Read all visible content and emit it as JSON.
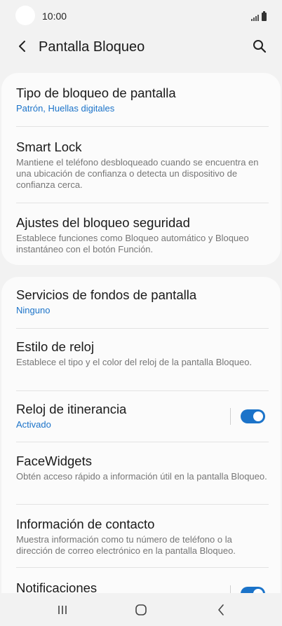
{
  "status_bar": {
    "time": "10:00"
  },
  "app_bar": {
    "title": "Pantalla Bloqueo"
  },
  "colors": {
    "accent": "#1b73c9",
    "background": "#f2f2f2",
    "card": "#fbfbfb"
  },
  "card1": {
    "items": [
      {
        "title": "Tipo de bloqueo de pantalla",
        "subtitle": "Patrón, Huellas digitales"
      },
      {
        "title": "Smart Lock",
        "subtitle": "Mantiene el teléfono desbloqueado cuando se encuentra en una ubicación de confianza o detecta un dispositivo de confianza cerca."
      },
      {
        "title": "Ajustes del bloqueo seguridad",
        "subtitle": "Establece funciones como Bloqueo automático y Bloqueo instantáneo con el botón Función."
      }
    ]
  },
  "card2": {
    "items": [
      {
        "title": "Servicios de fondos de pantalla",
        "subtitle": "Ninguno"
      },
      {
        "title": "Estilo de reloj",
        "subtitle": "Establece el tipo y el color del reloj de la pantalla Bloqueo."
      },
      {
        "title": "Reloj de itinerancia",
        "subtitle": "Activado",
        "toggle_on": true
      },
      {
        "title": "FaceWidgets",
        "subtitle": "Obtén acceso rápido a información útil en la pantalla Bloqueo."
      },
      {
        "title": "Información de contacto",
        "subtitle": "Muestra información como tu número de teléfono o la dirección de correo electrónico en la pantalla Bloqueo."
      },
      {
        "title": "Notificaciones",
        "toggle_on": true
      }
    ]
  },
  "icons": {
    "back": "back-arrow-icon",
    "search": "search-icon",
    "recents": "recents-icon",
    "home": "home-icon",
    "nav_back": "nav-back-icon"
  }
}
